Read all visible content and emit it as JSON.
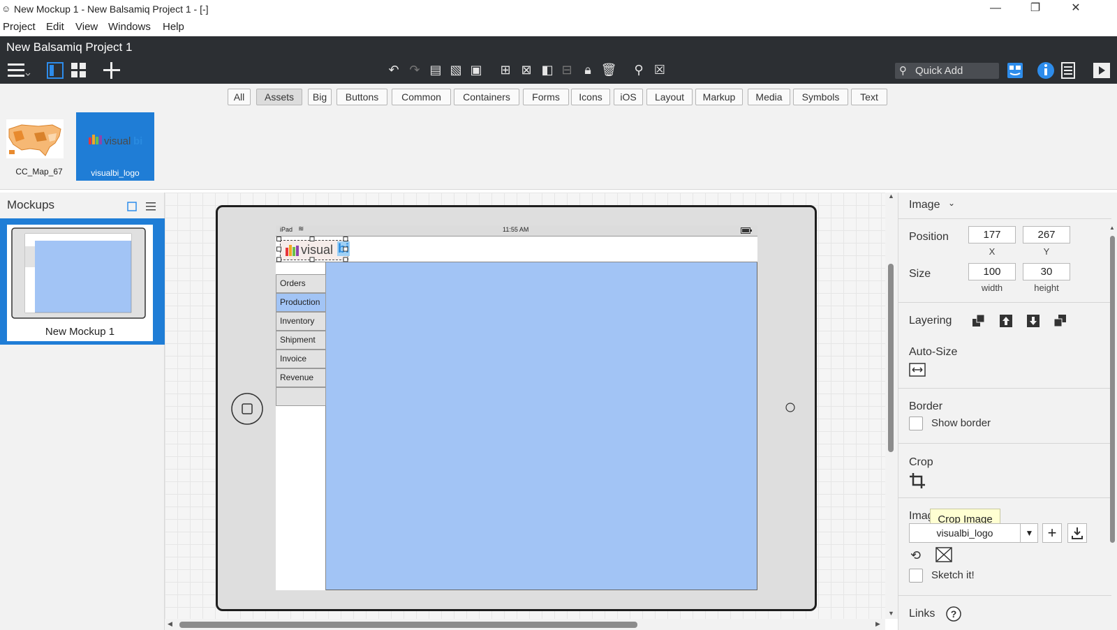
{
  "window": {
    "title": "New Mockup 1 - New Balsamiq Project 1 - [-]",
    "minimize": "—",
    "restore": "❐",
    "close": "✕"
  },
  "menubar": [
    "Project",
    "Edit",
    "View",
    "Windows",
    "Help"
  ],
  "project": {
    "name": "New Balsamiq Project 1",
    "quick_add": "Quick Add"
  },
  "library_filters": [
    "All",
    "Assets",
    "Big",
    "Buttons",
    "Common",
    "Containers",
    "Forms",
    "Icons",
    "iOS",
    "Layout",
    "Markup",
    "Media",
    "Symbols",
    "Text"
  ],
  "selected_filter": "Assets",
  "assets": [
    {
      "label": "CC_Map_67"
    },
    {
      "label": "visualbi_logo"
    }
  ],
  "mockups_panel": {
    "title": "Mockups",
    "items": [
      {
        "label": "New Mockup 1"
      }
    ]
  },
  "canvas": {
    "status_device": "iPad",
    "status_time": "11:55 AM",
    "logo_text": "visual",
    "logo_tail": "bi",
    "nav_items": [
      "Orders",
      "Production",
      "Inventory",
      "Shipment",
      "Invoice",
      "Revenue",
      ""
    ],
    "selected_nav": "Production"
  },
  "properties": {
    "type": "Image",
    "position_label": "Position",
    "x": "177",
    "x_caption": "X",
    "y": "267",
    "y_caption": "Y",
    "size_label": "Size",
    "width": "100",
    "width_caption": "width",
    "height": "30",
    "height_caption": "height",
    "layering_label": "Layering",
    "autosize_label": "Auto-Size",
    "border_label": "Border",
    "show_border_label": "Show border",
    "crop_label": "Crop",
    "image_label": "Imag",
    "image_value": "visualbi_logo",
    "sketch_label": "Sketch it!",
    "links_label": "Links",
    "tooltip": "Crop Image"
  },
  "colors": {
    "accent": "#1f7dd6",
    "toolbar_bg": "#2c2f33",
    "mockup_blue": "#a2c4f5"
  }
}
